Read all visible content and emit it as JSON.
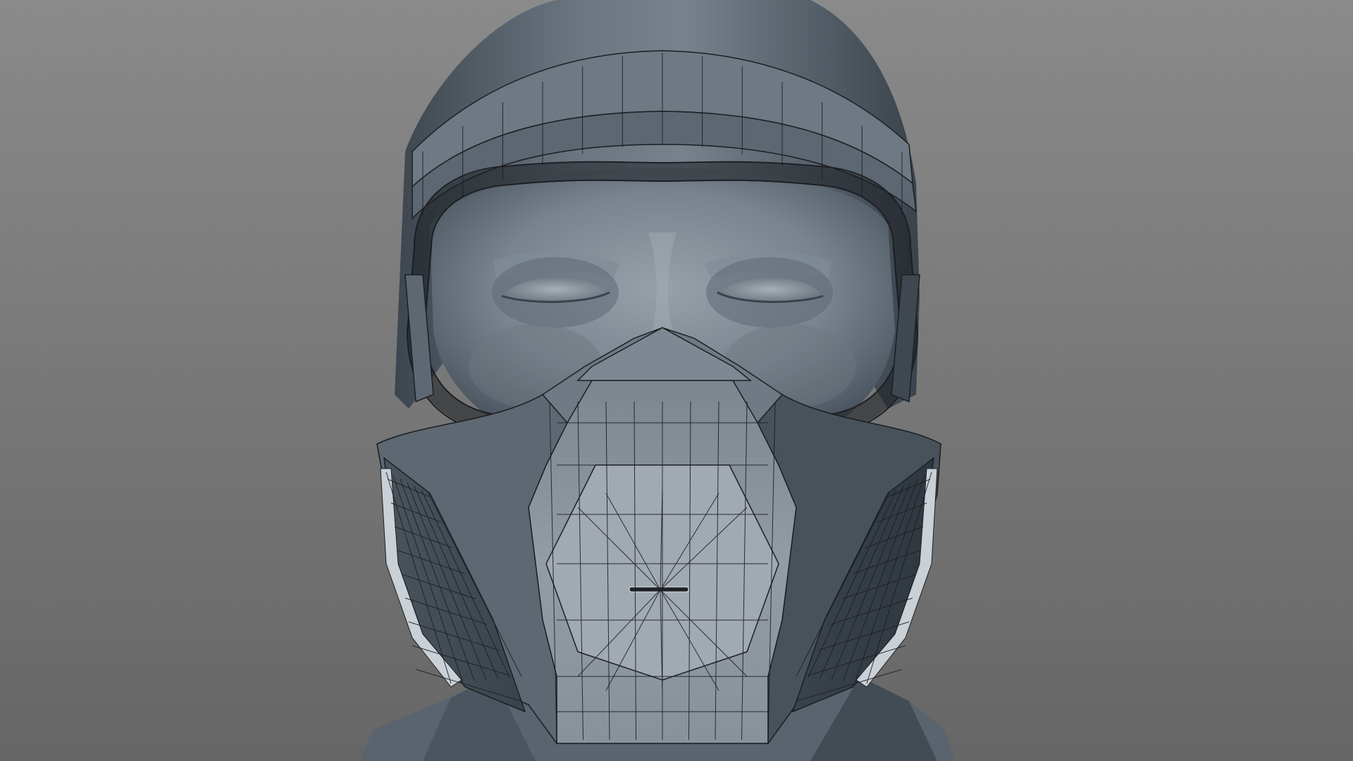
{
  "viewport": {
    "background_top": "#8a8a8a",
    "background_bottom": "#666666"
  },
  "materials": {
    "skin_light": "#909aa3",
    "skin_mid": "#6f7a84",
    "skin_dark": "#46505a",
    "skin_shadow": "#303840",
    "mask_light": "#9aa3ab",
    "wire": "#1c1f23"
  },
  "scene": {
    "objects": [
      {
        "id": "head",
        "label": ""
      },
      {
        "id": "helmet",
        "label": ""
      },
      {
        "id": "goggle-frame",
        "label": ""
      },
      {
        "id": "respirator-mask",
        "label": ""
      },
      {
        "id": "left-filter",
        "label": ""
      },
      {
        "id": "right-filter",
        "label": ""
      }
    ]
  }
}
